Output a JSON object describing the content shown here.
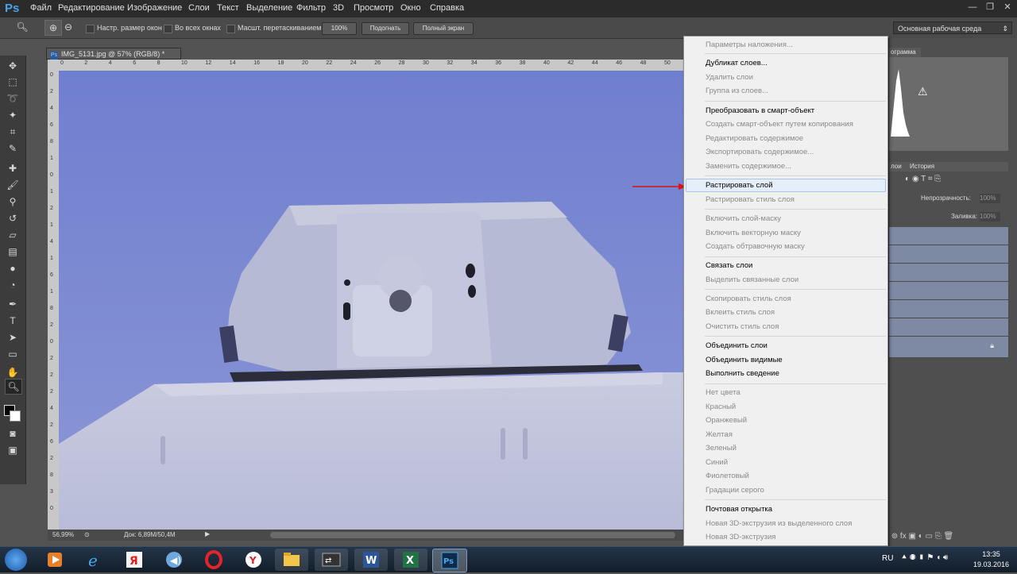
{
  "app": {
    "logo": "Ps",
    "menu": [
      "Файл",
      "Редактирование",
      "Изображение",
      "Слои",
      "Текст",
      "Выделение",
      "Фильтр",
      "3D",
      "Просмотр",
      "Окно",
      "Справка"
    ]
  },
  "options": {
    "checkboxes": [
      "Настр. размер окон",
      "Во всех окнах",
      "Масшт. перетаскиванием"
    ],
    "zoom_button": "100%",
    "fit_button": "Подогнать",
    "fullscreen_button": "Полный экран",
    "workspace": "Основная рабочая среда"
  },
  "document": {
    "tab_title": "IMG_5131.jpg @ 57% (RGB/8) *",
    "status_zoom": "56,99%",
    "status_doc": "Док: 6,89M/50,4M"
  },
  "ruler": {
    "top_labels": [
      "0",
      "2",
      "4",
      "6",
      "8",
      "10",
      "12",
      "14",
      "16",
      "18",
      "20",
      "22",
      "24",
      "26",
      "28",
      "30",
      "32",
      "34",
      "36",
      "38",
      "40",
      "42",
      "44",
      "46",
      "48",
      "50"
    ],
    "left_labels": [
      "0",
      "2",
      "4",
      "6",
      "8",
      "1",
      "0",
      "1",
      "2",
      "1",
      "4",
      "1",
      "6",
      "1",
      "8",
      "2",
      "0",
      "2",
      "2",
      "2",
      "4",
      "2",
      "6",
      "2",
      "8",
      "3",
      "0"
    ]
  },
  "panels": {
    "histogram_tab": "ограмма",
    "layers_tab": "лои",
    "history_tab": "История",
    "opacity_label": "Непрозрачность:",
    "opacity_value": "100%",
    "fill_label": "Заливка:",
    "fill_value": "100%"
  },
  "context_menu": {
    "items": [
      {
        "label": "Параметры наложения...",
        "enabled": false
      },
      {
        "label": "Дубликат слоев...",
        "enabled": true
      },
      {
        "label": "Удалить слои",
        "enabled": false
      },
      {
        "label": "Группа из слоев...",
        "enabled": false
      },
      {
        "label": "Преобразовать в смарт-объект",
        "enabled": true
      },
      {
        "label": "Создать смарт-объект путем копирования",
        "enabled": false
      },
      {
        "label": "Редактировать содержимое",
        "enabled": false
      },
      {
        "label": "Экспортировать содержимое...",
        "enabled": false
      },
      {
        "label": "Заменить содержимое...",
        "enabled": false
      },
      {
        "label": "Растрировать слой",
        "enabled": true,
        "highlighted": true
      },
      {
        "label": "Растрировать стиль слоя",
        "enabled": false
      },
      {
        "label": "Включить слой-маску",
        "enabled": false
      },
      {
        "label": "Включить векторную маску",
        "enabled": false
      },
      {
        "label": "Создать обтравочную маску",
        "enabled": false
      },
      {
        "label": "Связать слои",
        "enabled": true
      },
      {
        "label": "Выделить связанные слои",
        "enabled": false
      },
      {
        "label": "Скопировать стиль слоя",
        "enabled": false
      },
      {
        "label": "Вклеить стиль слоя",
        "enabled": false
      },
      {
        "label": "Очистить стиль слоя",
        "enabled": false
      },
      {
        "label": "Объединить слои",
        "enabled": true
      },
      {
        "label": "Объединить видимые",
        "enabled": true
      },
      {
        "label": "Выполнить сведение",
        "enabled": true
      },
      {
        "label": "Нет цвета",
        "enabled": false
      },
      {
        "label": "Красный",
        "enabled": false
      },
      {
        "label": "Оранжевый",
        "enabled": false
      },
      {
        "label": "Желтая",
        "enabled": false
      },
      {
        "label": "Зеленый",
        "enabled": false
      },
      {
        "label": "Синий",
        "enabled": false
      },
      {
        "label": "Фиолетовый",
        "enabled": false
      },
      {
        "label": "Градации серого",
        "enabled": false
      },
      {
        "label": "Почтовая открытка",
        "enabled": true
      },
      {
        "label": "Новая 3D-экструзия из выделенного слоя",
        "enabled": false
      },
      {
        "label": "Новая 3D-экструзия",
        "enabled": false
      }
    ]
  },
  "taskbar": {
    "lang": "RU",
    "time": "13:35",
    "date": "19.03.2016"
  },
  "colors": {
    "canvas_bg": "#7d8bd3",
    "menu_bg": "#f0f0f0",
    "arrow": "#e01010"
  }
}
